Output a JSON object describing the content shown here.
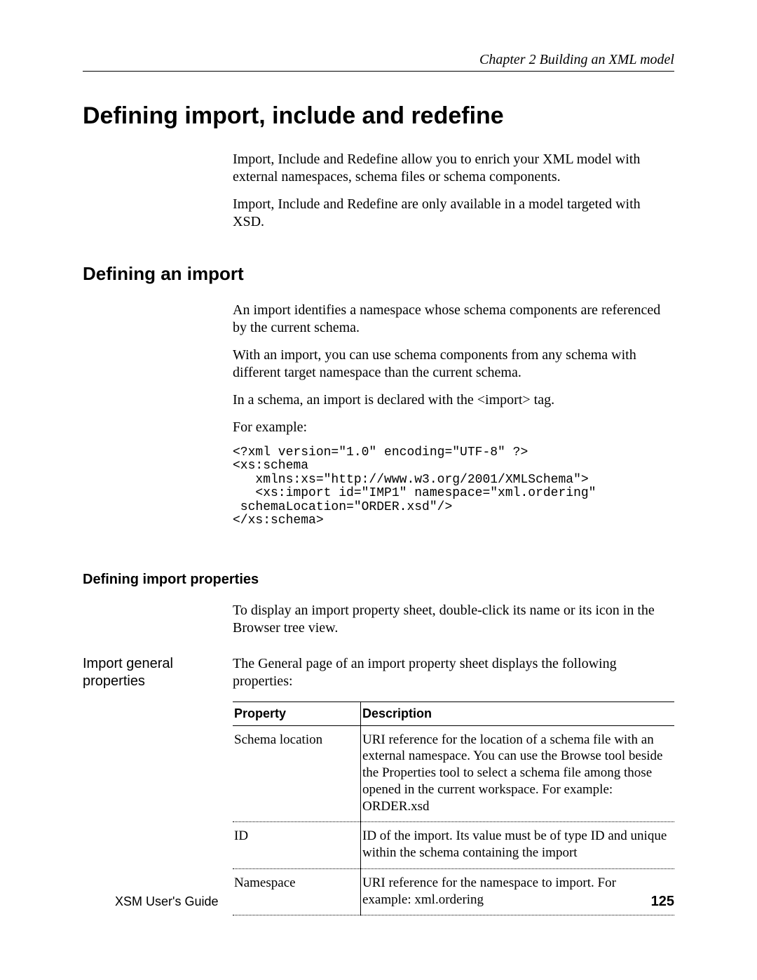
{
  "header": {
    "chapter": "Chapter 2  Building an XML model"
  },
  "title": "Defining import, include and redefine",
  "intro": {
    "p1": "Import, Include and Redefine allow you to enrich your XML model with external namespaces, schema files or schema components.",
    "p2": "Import, Include and Redefine are only available in a model targeted with XSD."
  },
  "section": {
    "title": "Defining an import",
    "p1": "An import identifies a namespace whose schema components are referenced by the current schema.",
    "p2": "With an import, you can use schema components from any schema with different target namespace than the current schema.",
    "p3": "In a schema, an import is declared with the <import> tag.",
    "p4": "For example:",
    "code": "<?xml version=\"1.0\" encoding=\"UTF-8\" ?>\n<xs:schema\n   xmlns:xs=\"http://www.w3.org/2001/XMLSchema\">\n   <xs:import id=\"IMP1\" namespace=\"xml.ordering\"\n schemaLocation=\"ORDER.xsd\"/>\n</xs:schema>"
  },
  "subsection": {
    "title": "Defining import properties",
    "p1": "To display an import property sheet, double-click its name or its icon in the Browser tree view.",
    "sidebar": "Import general properties",
    "p2": "The General page of an import property sheet displays the following properties:",
    "table": {
      "head": {
        "c1": "Property",
        "c2": "Description"
      },
      "rows": [
        {
          "c1": "Schema location",
          "c2": "URI reference for the location of a schema file with an external namespace. You can use the Browse tool beside the Properties tool to select a schema file among those opened in the current workspace. For example: ORDER.xsd"
        },
        {
          "c1": "ID",
          "c2": "ID of the import. Its value must be of type ID and unique within the schema containing the import"
        },
        {
          "c1": "Namespace",
          "c2": "URI reference for the namespace to import. For example: xml.ordering"
        }
      ]
    }
  },
  "footer": {
    "left": "XSM User's Guide",
    "right": "125"
  }
}
